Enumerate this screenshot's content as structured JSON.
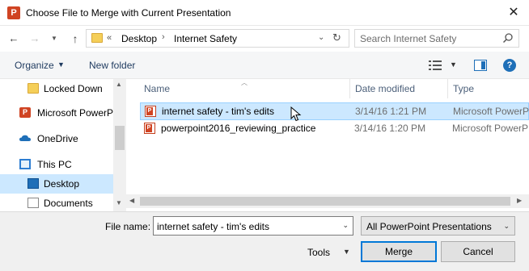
{
  "window": {
    "title": "Choose File to Merge with Current Presentation",
    "app_icon": "powerpoint-icon",
    "close_glyph": "✕"
  },
  "address": {
    "overflow_marker": "«",
    "breadcrumbs": [
      "Desktop",
      "Internet Safety"
    ]
  },
  "search": {
    "placeholder": "Search Internet Safety"
  },
  "toolbar": {
    "organize_label": "Organize",
    "new_folder_label": "New folder",
    "help_label": "?"
  },
  "nav": {
    "items": [
      {
        "label": "Locked Down",
        "icon": "folder-icon"
      },
      {
        "label": "Microsoft PowerP",
        "icon": "powerpoint-icon"
      },
      {
        "label": "OneDrive",
        "icon": "onedrive-cloud-icon"
      },
      {
        "label": "This PC",
        "icon": "computer-icon"
      },
      {
        "label": "Desktop",
        "icon": "desktop-icon",
        "selected": true
      },
      {
        "label": "Documents",
        "icon": "documents-icon"
      }
    ]
  },
  "files": {
    "columns": {
      "name": "Name",
      "date": "Date modified",
      "type": "Type"
    },
    "rows": [
      {
        "name": "internet safety - tim's edits",
        "date": "3/14/16 1:21 PM",
        "type": "Microsoft PowerP",
        "selected": true
      },
      {
        "name": "powerpoint2016_reviewing_practice",
        "date": "3/14/16 1:20 PM",
        "type": "Microsoft PowerP",
        "selected": false
      }
    ]
  },
  "footer": {
    "file_name_label": "File name:",
    "file_name_value": "internet safety - tim's edits",
    "filter_value": "All PowerPoint Presentations",
    "tools_label": "Tools",
    "merge_label": "Merge",
    "cancel_label": "Cancel"
  },
  "colors": {
    "selection": "#cce8ff",
    "selection_border": "#99d1ff",
    "accent": "#0078d7",
    "powerpoint": "#d04423"
  }
}
